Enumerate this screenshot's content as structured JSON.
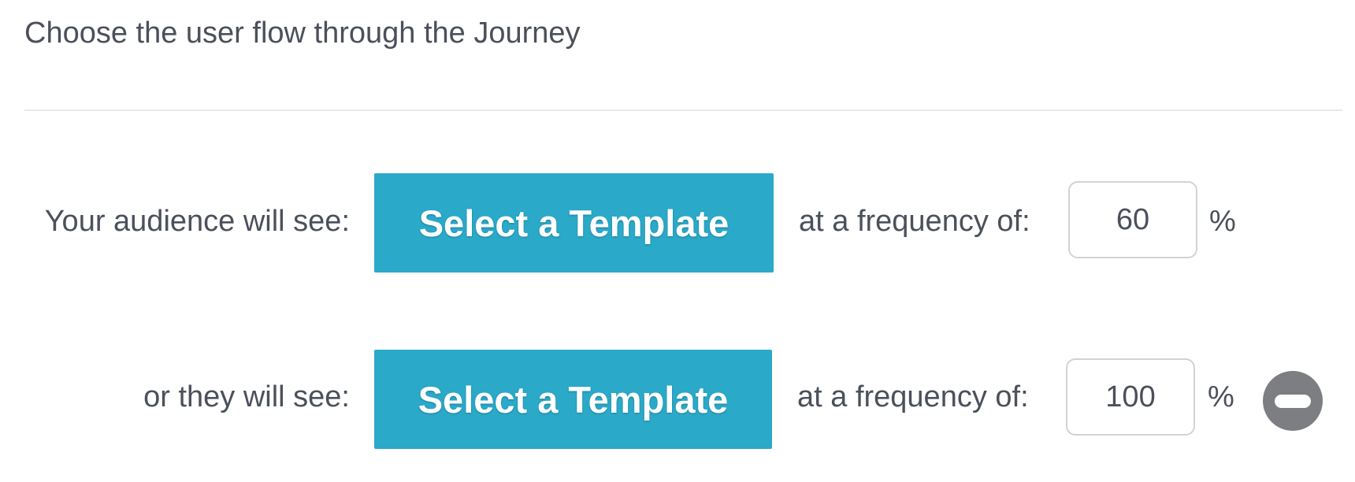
{
  "heading": "Choose the user flow through the Journey",
  "rows": [
    {
      "label": "Your audience will see:",
      "button_label": "Select a Template",
      "frequency_label": "at a frequency of:",
      "frequency_value": "60",
      "unit": "%"
    },
    {
      "label": "or they will see:",
      "button_label": "Select a Template",
      "frequency_label": "at a frequency of:",
      "frequency_value": "100",
      "unit": "%",
      "remove_icon": "minus-circle-icon"
    }
  ],
  "colors": {
    "button": "#2aa9c9",
    "remove_icon": "#7d7e81",
    "text": "#4b505b"
  }
}
